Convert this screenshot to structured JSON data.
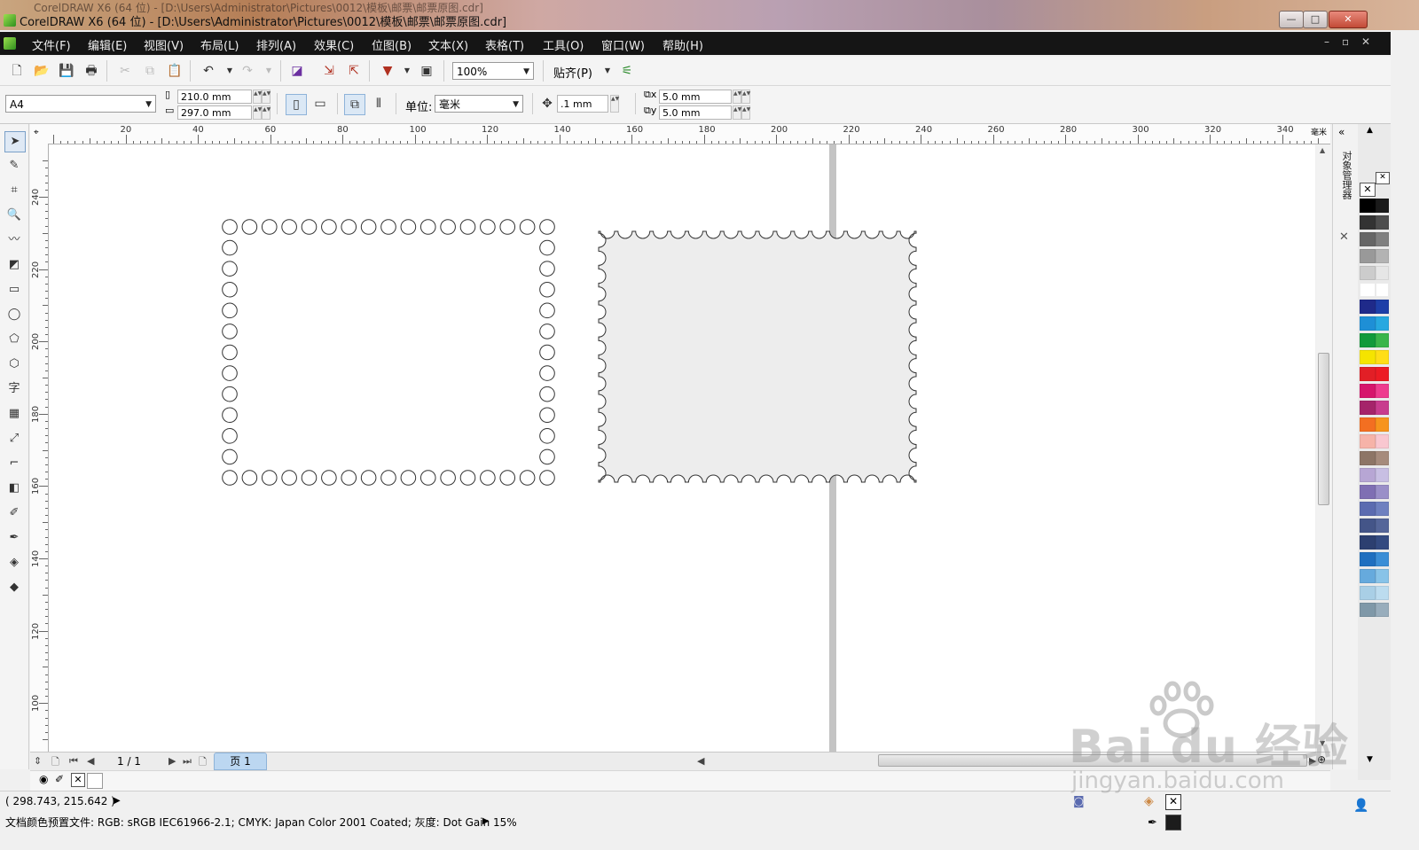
{
  "window": {
    "background_title": "CorelDRAW X6 (64 位) - [D:\\Users\\Administrator\\Pictures\\0012\\模板\\邮票\\邮票原图.cdr]",
    "title": "CorelDRAW X6 (64 位) - [D:\\Users\\Administrator\\Pictures\\0012\\模板\\邮票\\邮票原图.cdr]",
    "minimize": "—",
    "maximize": "□",
    "close": "✕"
  },
  "menu": {
    "items": [
      "文件(F)",
      "编辑(E)",
      "视图(V)",
      "布局(L)",
      "排列(A)",
      "效果(C)",
      "位图(B)",
      "文本(X)",
      "表格(T)",
      "工具(O)",
      "窗口(W)",
      "帮助(H)"
    ],
    "doc_controls": [
      "–",
      "▫",
      "✕"
    ]
  },
  "toolbar": {
    "zoom": "100%",
    "snap_label": "贴齐(P)"
  },
  "property_bar": {
    "page_size": "A4",
    "width": "210.0 mm",
    "height": "297.0 mm",
    "units_label": "单位:",
    "units_value": "毫米",
    "nudge": ".1 mm",
    "dup_x": "5.0 mm",
    "dup_y": "5.0 mm"
  },
  "ruler": {
    "unit": "毫米",
    "h_labels": [
      "20",
      "40",
      "60",
      "80",
      "100",
      "120",
      "140",
      "160",
      "180",
      "200",
      "220",
      "240",
      "260",
      "280",
      "300",
      "320",
      "340"
    ],
    "v_labels": [
      "240",
      "220",
      "200",
      "180",
      "160",
      "140",
      "120",
      "100"
    ]
  },
  "page_nav": {
    "count": "1 / 1",
    "tab": "页 1"
  },
  "docker": {
    "title": "对象管理器"
  },
  "status": {
    "coords": "( 298.743, 215.642 )",
    "profile": "文档颜色预置文件: RGB: sRGB IEC61966-2.1; CMYK: Japan Color 2001 Coated; 灰度: Dot Gain 15%"
  },
  "watermark": {
    "logo": "Bai du 经验",
    "url": "jingyan.baidu.com"
  },
  "colors": {
    "menubar": "#151515",
    "stamp_fill": "#ededed",
    "page_edge": "#c4c4c4",
    "page_tab": "#bcd7f1",
    "palette": [
      "#000000",
      "#1a1a1a",
      "#333333",
      "#4d4d4d",
      "#666666",
      "#808080",
      "#999999",
      "#b3b3b3",
      "#cccccc",
      "#e6e6e6",
      "#ffffff",
      "#ffffff",
      "#1f2a8a",
      "#1e3fa8",
      "#1e8fd6",
      "#27a8e0",
      "#119a3b",
      "#39b54a",
      "#f5e400",
      "#ffde17",
      "#e21f26",
      "#ec1c24",
      "#d6156c",
      "#ee3c8f",
      "#a5246a",
      "#c83c8e",
      "#f36f21",
      "#f7941d",
      "#f6b3a8",
      "#f9c7d0",
      "#8d7566",
      "#a68b7c",
      "#b7a6d4",
      "#c8bfe3",
      "#7f6fb3",
      "#9a8fc8",
      "#5b6bb0",
      "#6e80c0",
      "#445588",
      "#556699",
      "#2c3f70",
      "#334a80",
      "#1f6fbf",
      "#3b8ed6",
      "#66aadd",
      "#88c3e8",
      "#a9cfe6",
      "#bcdcef",
      "#7f98a8",
      "#98adbc"
    ]
  }
}
